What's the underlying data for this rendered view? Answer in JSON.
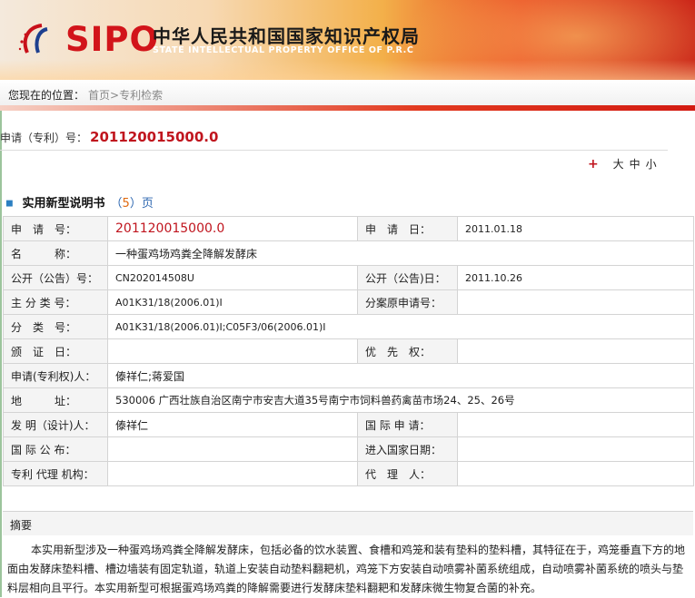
{
  "header": {
    "logo_text": "SIPO",
    "org_cn": "中华人民共和国国家知识产权局",
    "org_en": "STATE INTELLECTUAL PROPERTY OFFICE OF P.R.C"
  },
  "breadcrumb": {
    "label": "您现在的位置：",
    "home": "首页",
    "sep": ">",
    "current": "专利检索"
  },
  "application": {
    "label": "申请（专利）号：",
    "number": "201120015000.0"
  },
  "font_size": {
    "plus": "+",
    "large": "大",
    "medium": "中",
    "small": "小"
  },
  "spec": {
    "title": "实用新型说明书",
    "open": "（",
    "pages": "5",
    "close": "）",
    "page_unit": "页"
  },
  "table": {
    "rows": [
      {
        "l1": "申　请　号：",
        "v1": "201120015000.0",
        "l2": "申　请　日：",
        "v2": "2011.01.18"
      },
      {
        "l1": "名　　　称：",
        "v1": "一种蛋鸡场鸡粪全降解发酵床"
      },
      {
        "l1": "公开（公告）号：",
        "v1": "CN202014508U",
        "l2": "公开（公告)日：",
        "v2": "2011.10.26"
      },
      {
        "l1": "主 分 类 号：",
        "v1": "A01K31/18(2006.01)I",
        "l2": "分案原申请号：",
        "v2": ""
      },
      {
        "l1": "分　类　号：",
        "v1": "A01K31/18(2006.01)I;C05F3/06(2006.01)I"
      },
      {
        "l1": "颁　证　日：",
        "v1": "",
        "l2": "优　先　权：",
        "v2": ""
      },
      {
        "l1": "申请(专利权)人：",
        "v1": "傣祥仁;蒋爱国"
      },
      {
        "l1": "地　　　址：",
        "v1": "530006 广西壮族自治区南宁市安吉大道35号南宁市饲料兽药禽苗市场24、25、26号"
      },
      {
        "l1": "发 明（设计)人：",
        "v1": "傣祥仁",
        "l2": "国 际 申 请：",
        "v2": ""
      },
      {
        "l1": "国 际 公 布：",
        "v1": "",
        "l2": "进入国家日期：",
        "v2": ""
      },
      {
        "l1": "专利 代理 机构：",
        "v1": "",
        "l2": "代　理　人：",
        "v2": ""
      }
    ]
  },
  "abstract": {
    "heading": "摘要",
    "text": "本实用新型涉及一种蛋鸡场鸡粪全降解发酵床，包括必备的饮水装置、食槽和鸡笼和装有垫料的垫料槽，其特征在于，鸡笼垂直下方的地面由发酵床垫料槽、槽边墙装有固定轨道，轨道上安装自动垫料翻耙机，鸡笼下方安装自动喷雾补菌系统组成，自动喷雾补菌系统的喷头与垫料层相向且平行。本实用新型可根据蛋鸡场鸡粪的降解需要进行发酵床垫料翻耙和发酵床微生物复合菌的补充。"
  }
}
